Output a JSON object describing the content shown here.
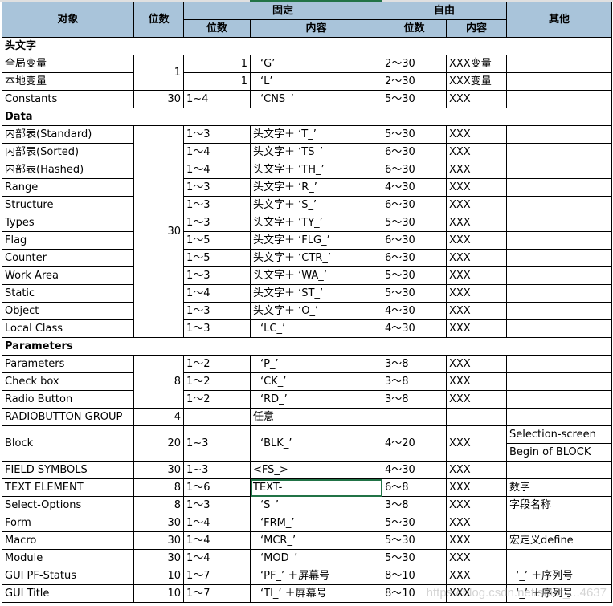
{
  "header": {
    "object": "对象",
    "length": "位数",
    "fixed": "固定",
    "free": "自由",
    "other": "其他",
    "fixed_length": "位数",
    "fixed_content": "内容",
    "free_length": "位数",
    "free_content": "内容"
  },
  "rows": [
    {
      "section": "头文字"
    },
    {
      "obj": "全局变量",
      "len": "1",
      "lenSpan": 2,
      "fl": "1",
      "flRight": true,
      "fc": "‘G’",
      "fcIndent": true,
      "vl": "2～30",
      "vc": "XXX变量",
      "ot": ""
    },
    {
      "obj": "本地变量",
      "fl": "1",
      "flRight": true,
      "fc": "‘L’",
      "fcIndent": true,
      "vl": "2～30",
      "vc": "XXX变量",
      "ot": ""
    },
    {
      "obj": "Constants",
      "len": "30",
      "fl": "1~4",
      "fc": "‘CNS_’",
      "fcIndent": true,
      "vl": "5～30",
      "vc": "XXX",
      "ot": ""
    },
    {
      "section": "Data"
    },
    {
      "obj": "内部表(Standard)",
      "len": "30",
      "lenSpan": 12,
      "fl": "1～3",
      "fc": "头文字＋ ‘T_’",
      "vl": "5～30",
      "vc": "XXX",
      "ot": ""
    },
    {
      "obj": "内部表(Sorted)",
      "fl": "1～4",
      "fc": "头文字＋ ‘TS_’",
      "vl": "6～30",
      "vc": "XXX",
      "ot": ""
    },
    {
      "obj": "内部表(Hashed)",
      "fl": "1～4",
      "fc": "头文字＋ ‘TH_’",
      "vl": "6～30",
      "vc": "XXX",
      "ot": ""
    },
    {
      "obj": "Range",
      "fl": "1～3",
      "fc": "头文字＋ ‘R_’",
      "vl": "4～30",
      "vc": "XXX",
      "ot": ""
    },
    {
      "obj": "Structure",
      "fl": "1～3",
      "fc": "头文字＋ ‘S_’",
      "vl": "6～30",
      "vc": "XXX",
      "ot": ""
    },
    {
      "obj": "Types",
      "fl": "1～3",
      "fc": "头文字＋ ‘TY_’",
      "vl": "5～30",
      "vc": "XXX",
      "ot": ""
    },
    {
      "obj": "Flag",
      "fl": "1～5",
      "fc": "头文字＋ ‘FLG_’",
      "vl": "6～30",
      "vc": "XXX",
      "ot": ""
    },
    {
      "obj": "Counter",
      "fl": "1～5",
      "fc": "头文字＋ ‘CTR_’",
      "vl": "6～30",
      "vc": "XXX",
      "ot": ""
    },
    {
      "obj": "Work Area",
      "fl": "1～3",
      "fc": "头文字＋ ‘WA_’",
      "vl": "5～30",
      "vc": "XXX",
      "ot": ""
    },
    {
      "obj": "Static",
      "fl": "1～4",
      "fc": "头文字＋ ‘ST_’",
      "vl": "5～30",
      "vc": "XXX",
      "ot": ""
    },
    {
      "obj": "Object",
      "fl": "1～3",
      "fc": "头文字＋ ‘O_’",
      "vl": "4～30",
      "vc": "XXX",
      "ot": ""
    },
    {
      "obj": "Local Class",
      "fl": "1～3",
      "fc": "‘LC_’",
      "fcIndent": true,
      "vl": "4～30",
      "vc": "XXX",
      "ot": ""
    },
    {
      "section": "Parameters"
    },
    {
      "obj": "Parameters",
      "len": "8",
      "lenSpan": 3,
      "fl": "1～2",
      "fc": "‘P_’",
      "fcIndent": true,
      "vl": "3～8",
      "vc": "XXX",
      "ot": ""
    },
    {
      "obj": "Check box",
      "fl": "1～2",
      "fc": "‘CK_’",
      "fcIndent": true,
      "vl": "3～8",
      "vc": "XXX",
      "ot": ""
    },
    {
      "obj": "Radio Button",
      "fl": "1～2",
      "fc": "‘RD_’",
      "fcIndent": true,
      "vl": "3～8",
      "vc": "XXX",
      "ot": ""
    },
    {
      "obj": "RADIOBUTTON GROUP",
      "len": "4",
      "fl": "",
      "fc": "任意",
      "vl": "",
      "vc": "",
      "ot": ""
    },
    {
      "obj": "Block",
      "len": "20",
      "fl": "1~3",
      "fc": "‘BLK_’",
      "fcIndent": true,
      "vl": "4～20",
      "vc": "XXX",
      "ot": "Selection-screen",
      "ot2": "Begin of BLOCK"
    },
    {
      "obj": "FIELD SYMBOLS",
      "len": "30",
      "fl": "1~3",
      "fc": "<FS_>",
      "vl": "4～30",
      "vc": "XXX",
      "ot": ""
    },
    {
      "obj": "TEXT ELEMENT",
      "len": "8",
      "fl": "1～6",
      "fc": "TEXT-",
      "selected": true,
      "vl": "6～8",
      "vc": "XXX",
      "ot": "数字"
    },
    {
      "obj": "Select-Options",
      "len": "8",
      "fl": "1～3",
      "fc": "‘S_’",
      "fcIndent": true,
      "vl": "3～8",
      "vc": "XXX",
      "ot": "字段名称"
    },
    {
      "obj": "Form",
      "len": "30",
      "fl": "1～4",
      "fc": "‘FRM_’",
      "fcIndent": true,
      "vl": "5～30",
      "vc": "XXX",
      "ot": ""
    },
    {
      "obj": "Macro",
      "len": "30",
      "fl": "1～4",
      "fc": "‘MCR_’",
      "fcIndent": true,
      "vl": "5～30",
      "vc": "XXX",
      "ot": "宏定义define"
    },
    {
      "obj": "Module",
      "len": "30",
      "fl": "1～4",
      "fc": "‘MOD_’",
      "fcIndent": true,
      "vl": "5～30",
      "vc": "XXX",
      "ot": ""
    },
    {
      "obj": "GUI PF-Status",
      "len": "10",
      "fl": "1～7",
      "fc": "‘PF_’ ＋屏幕号",
      "fcIndent": true,
      "vl": "8～10",
      "vc": "XXX",
      "ot": "  ‘_’ ＋序列号"
    },
    {
      "obj": "GUI Title",
      "len": "10",
      "fl": "1～7",
      "fc": "‘TI_’ ＋屏幕号",
      "fcIndent": true,
      "vl": "8～10",
      "vc": "XXX",
      "ot": "  ‘_’ ＋序列号"
    }
  ],
  "colors": {
    "header_bg": "#a9c4da",
    "selection": "#217346"
  }
}
